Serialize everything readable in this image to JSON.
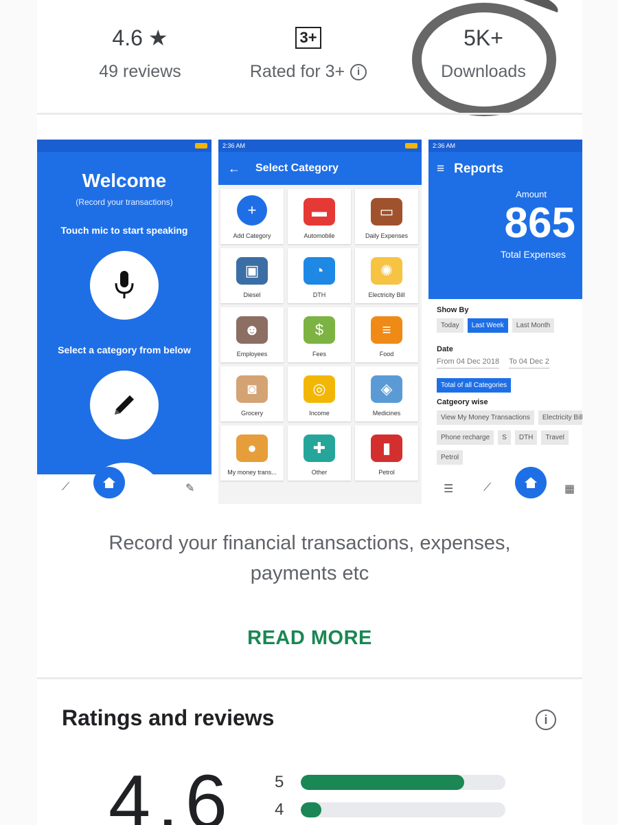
{
  "stats": {
    "rating": {
      "value": "4.6",
      "reviews": "49 reviews"
    },
    "age": {
      "badge": "3+",
      "label": "Rated for 3+"
    },
    "downloads": {
      "value": "5K+",
      "label": "Downloads"
    }
  },
  "screenshots": {
    "welcome": {
      "title": "Welcome",
      "subtitle": "(Record your transactions)",
      "mic_prompt": "Touch mic to start speaking",
      "category_prompt": "Select a category from below"
    },
    "category": {
      "time": "2:36 AM",
      "title": "Select Category",
      "tiles": [
        {
          "label": "Add Category",
          "icon": "add-icon",
          "color": "#1e6fe6"
        },
        {
          "label": "Automobile",
          "icon": "car-icon",
          "color": "#e53935"
        },
        {
          "label": "Daily Expenses",
          "icon": "wallet-icon",
          "color": "#a0522d"
        },
        {
          "label": "Diesel",
          "icon": "fuel-can-icon",
          "color": "#3b6ea5"
        },
        {
          "label": "DTH",
          "icon": "satellite-dish-icon",
          "color": "#1e88e5"
        },
        {
          "label": "Electricity Bill",
          "icon": "lightbulb-icon",
          "color": "#f6c343"
        },
        {
          "label": "Employees",
          "icon": "people-icon",
          "color": "#8d6e63"
        },
        {
          "label": "Fees",
          "icon": "money-icon",
          "color": "#7cb342"
        },
        {
          "label": "Food",
          "icon": "burger-icon",
          "color": "#ef8a17"
        },
        {
          "label": "Grocery",
          "icon": "grocery-bag-icon",
          "color": "#d4a373"
        },
        {
          "label": "Income",
          "icon": "coins-icon",
          "color": "#f2b705"
        },
        {
          "label": "Medicines",
          "icon": "pills-icon",
          "color": "#5b9bd5"
        },
        {
          "label": "My money trans...",
          "icon": "hand-coins-icon",
          "color": "#e59e3a"
        },
        {
          "label": "Other",
          "icon": "plus-circle-icon",
          "color": "#26a69a"
        },
        {
          "label": "Petrol",
          "icon": "fuel-pump-icon",
          "color": "#d32f2f"
        }
      ]
    },
    "reports": {
      "time": "2:36 AM",
      "title": "Reports",
      "amount_label": "Amount",
      "amount": "865",
      "total_label": "Total Expenses",
      "show_by_label": "Show By",
      "show_by_options": [
        "Today",
        "Last Week",
        "Last Month"
      ],
      "show_by_selected": "Last Week",
      "date_label": "Date",
      "from": "From 04 Dec 2018",
      "to": "To 04 Dec 2",
      "total_all": "Total of all Categories",
      "category_wise_label": "Catgeory wise",
      "category_chips": [
        "View My Money Transactions",
        "Electricity Bill",
        "Phone recharge",
        "S",
        "DTH",
        "Travel",
        "Petrol"
      ]
    }
  },
  "description": {
    "line1": "Record your financial transactions, expenses,",
    "line2": "payments etc"
  },
  "read_more": "READ MORE",
  "ratings": {
    "title": "Ratings and reviews",
    "score": "4.6",
    "bars": [
      {
        "stars": "5",
        "fraction": 0.8
      },
      {
        "stars": "4",
        "fraction": 0.1
      }
    ]
  },
  "colors": {
    "accent_green": "#1a8754",
    "app_blue": "#1e6fe6"
  }
}
